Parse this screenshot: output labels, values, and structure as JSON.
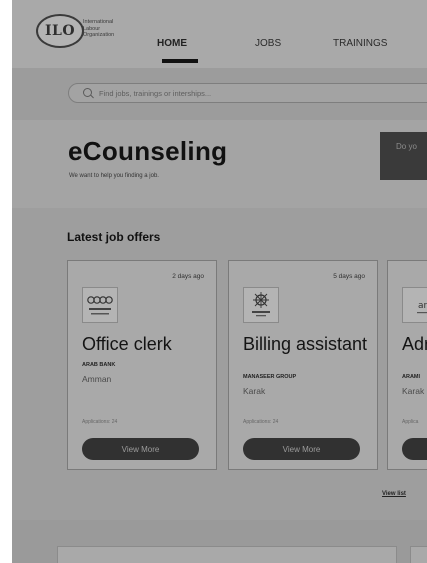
{
  "logo": {
    "badge": "ILO",
    "line1": "International",
    "line2": "Labour",
    "line3": "Organization"
  },
  "nav": {
    "home": "HOME",
    "jobs": "JOBS",
    "trainings": "TRAININGS"
  },
  "search": {
    "placeholder": "Find jobs, trainings or interships..."
  },
  "hero": {
    "title": "eCounseling",
    "subtitle": "We want to help you finding a job.",
    "cta": "Do yo"
  },
  "section": {
    "title": "Latest job offers",
    "view_list": "View list"
  },
  "jobs": [
    {
      "posted": "2 days ago",
      "title": "Office clerk",
      "company": "ARAB BANK",
      "location": "Amman",
      "applications": "Applications: 24",
      "button": "View More"
    },
    {
      "posted": "5 days ago",
      "title": "Billing assistant",
      "company": "MANASEER GROUP",
      "location": "Karak",
      "applications": "Applications: 24",
      "button": "View More"
    },
    {
      "posted": "",
      "title": "Adr Sta",
      "company": "ARAMI",
      "location": "Karak",
      "applications": "Applica",
      "button": ""
    }
  ]
}
